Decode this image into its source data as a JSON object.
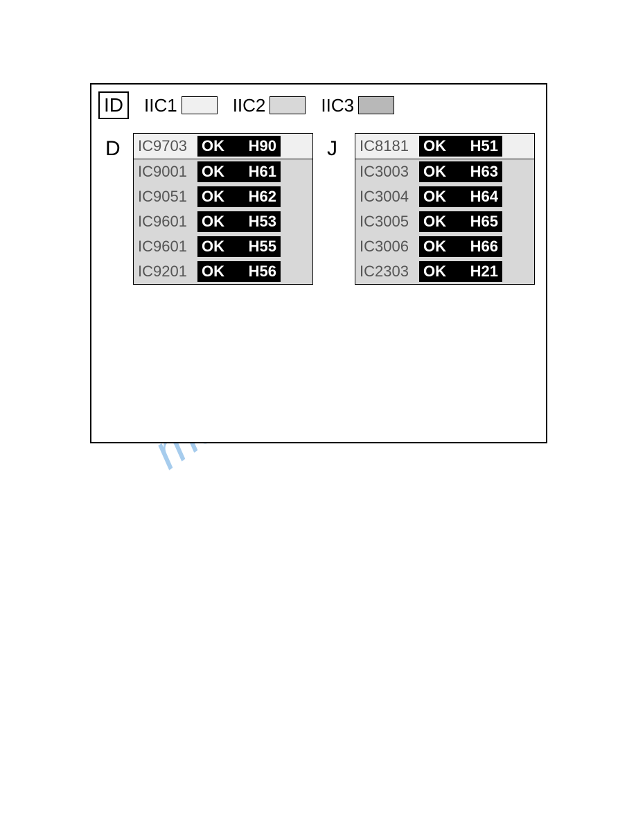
{
  "watermark": "manualshive.com",
  "legend": {
    "id_label": "ID",
    "items": [
      {
        "label": "IIC1"
      },
      {
        "label": "IIC2"
      },
      {
        "label": "IIC3"
      }
    ]
  },
  "columns": [
    {
      "letter": "D",
      "sections": [
        {
          "shade": "light",
          "rows": [
            {
              "ic": "IC9703",
              "status": "OK",
              "code": "H90"
            }
          ]
        },
        {
          "shade": "med",
          "rows": [
            {
              "ic": "IC9001",
              "status": "OK",
              "code": "H61"
            },
            {
              "ic": "IC9051",
              "status": "OK",
              "code": "H62"
            },
            {
              "ic": "IC9601",
              "status": "OK",
              "code": "H53"
            },
            {
              "ic": "IC9601",
              "status": "OK",
              "code": "H55"
            },
            {
              "ic": "IC9201",
              "status": "OK",
              "code": "H56"
            }
          ]
        }
      ]
    },
    {
      "letter": "J",
      "sections": [
        {
          "shade": "light",
          "rows": [
            {
              "ic": "IC8181",
              "status": "OK",
              "code": "H51"
            }
          ]
        },
        {
          "shade": "med",
          "rows": [
            {
              "ic": "IC3003",
              "status": "OK",
              "code": "H63"
            },
            {
              "ic": "IC3004",
              "status": "OK",
              "code": "H64"
            },
            {
              "ic": "IC3005",
              "status": "OK",
              "code": "H65"
            },
            {
              "ic": "IC3006",
              "status": "OK",
              "code": "H66"
            },
            {
              "ic": "IC2303",
              "status": "OK",
              "code": "H21"
            }
          ]
        }
      ]
    }
  ]
}
